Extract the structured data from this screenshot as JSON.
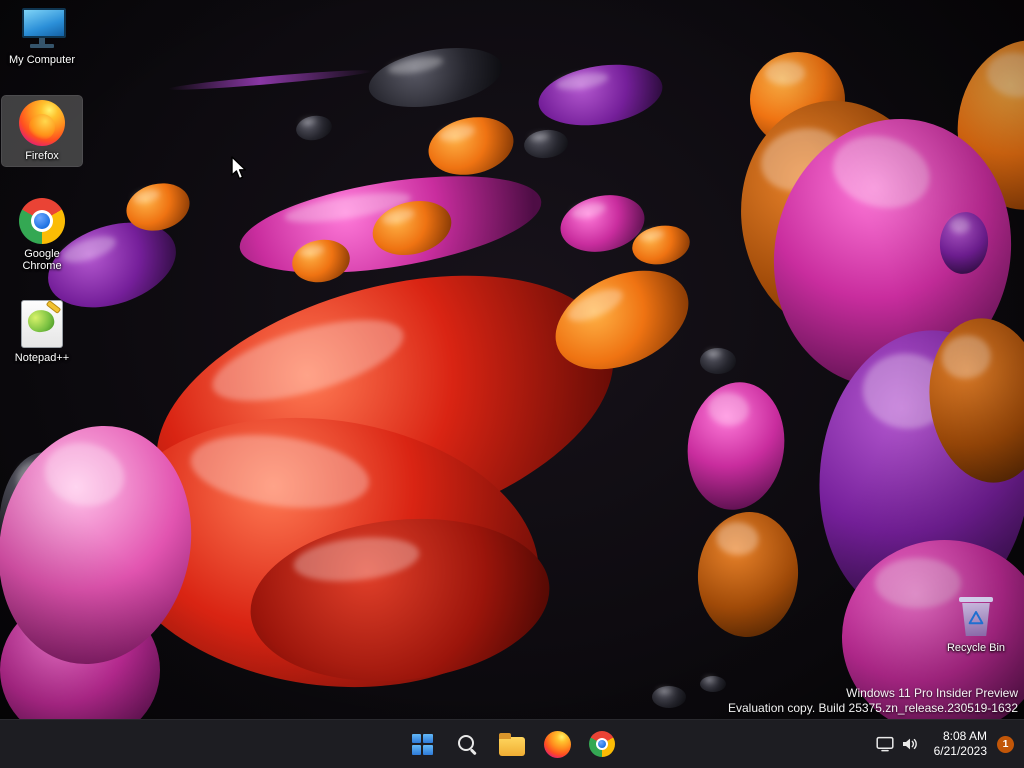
{
  "desktop": {
    "icons": [
      {
        "label": "My Computer",
        "icon": "computer-icon"
      },
      {
        "label": "Firefox",
        "icon": "firefox-icon",
        "selected": true
      },
      {
        "label": "Google Chrome",
        "icon": "chrome-icon"
      },
      {
        "label": "Notepad++",
        "icon": "notepadpp-icon"
      }
    ],
    "recycle_bin": {
      "label": "Recycle Bin",
      "icon": "recycle-bin-icon"
    },
    "watermark": {
      "line1": "Windows 11 Pro Insider Preview",
      "line2": "Evaluation copy. Build 25375.zn_release.230519-1632"
    }
  },
  "taskbar": {
    "buttons": [
      {
        "name": "start",
        "icon": "windows-start-icon"
      },
      {
        "name": "search",
        "icon": "search-icon"
      },
      {
        "name": "file-explorer",
        "icon": "folder-icon"
      },
      {
        "name": "firefox",
        "icon": "firefox-icon"
      },
      {
        "name": "chrome",
        "icon": "chrome-icon"
      }
    ],
    "tray": {
      "display_icon": "display-icon",
      "volume_icon": "speaker-icon",
      "time": "8:08 AM",
      "date": "6/21/2023",
      "notification_count": "1"
    }
  },
  "colors": {
    "taskbar_bg": "#1d1d22",
    "selection_highlight": "rgba(112,112,112,0.55)",
    "badge": "#c25608",
    "accent_blue": "#2e7ad8"
  }
}
